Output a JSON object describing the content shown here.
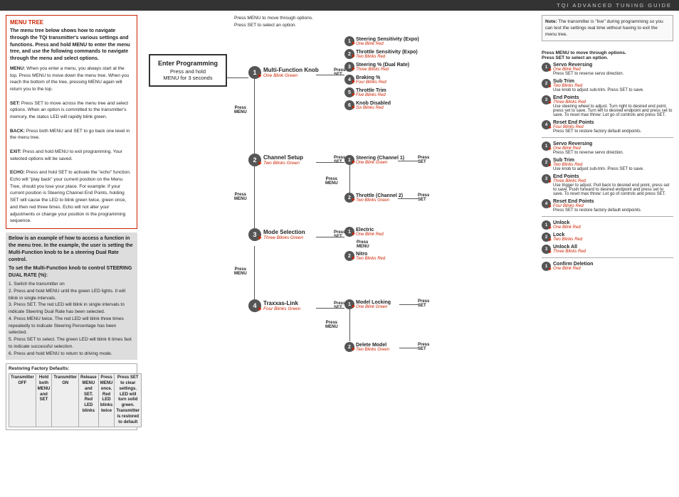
{
  "header": {
    "title": "TQi ADVANCED TUNING GUIDE"
  },
  "left_panel": {
    "menu_tree": {
      "title": "MENU TREE",
      "intro": "The menu tree below shows how to navigate through the TQi transmitter's various settings and functions. Press and hold MENU to enter the menu tree, and use the following commands to navigate through the menu and select options.",
      "items": [
        {
          "term": "MENU:",
          "description": "When you enter a menu, you always start at the top. Press MENU to move down the menu tree. When you reach the bottom of the tree, pressing MENU again will return you to the top."
        },
        {
          "term": "SET:",
          "description": "Press SET to move across the menu tree and select options. When an option is committed to the transmitter's memory, the status LED will rapidly blink green."
        },
        {
          "term": "BACK:",
          "description": "Press both MENU and SET to go back one level in the menu tree."
        },
        {
          "term": "EXIT:",
          "description": "Press and hold MENU to exit programming. Your selected options will be saved."
        },
        {
          "term": "ECHO:",
          "description": "Press and hold SET to activate the \"echo\" function. Echo will \"play back\" your current position on the Menu Tree, should you lose your place. For example: If your current position is Steering Channel End Points, holding SET will cause the LED to blink green twice, green once, and then red three times. Echo will not alter your adjustments or change your position in the programming sequence."
        }
      ]
    },
    "example": {
      "title": "Below is an example of how to access a function in the menu tree. In the example, the user is setting the Multi-Function knob to be a steering Dual Rate control.",
      "subtitle": "To set the Multi-Function knob to control STEERING DUAL RATE (%):",
      "steps": [
        "1. Switch the transmitter on",
        "2. Press and hold MENU until the green LED lights. It will blink in single intervals.",
        "3. Press SET. The red LED will blink in single intervals to indicate Steering Dual Rate has been selected.",
        "4. Press MENU twice. The red LED will blink three times repeatedly to indicate Steering Percentage has been selected.",
        "5. Press SET to select. The green LED will blink 6 times fast to indicate successful selection.",
        "6. Press and hold MENU to return to driving mode."
      ]
    },
    "factory_defaults": {
      "title": "Restoring Factory Defaults:",
      "columns": [
        "Transmitter OFF",
        "Hold both MENU and SET",
        "Transmitter ON",
        "Release MENU and SET. Red LED blinks",
        "Press MENU once. Red LED blinks twice",
        "Press SET to clear settings. LED will turn solid green. Transmitter is restored to default"
      ]
    }
  },
  "entry_box": {
    "title": "Enter Programming",
    "subtitle": "Press and hold",
    "detail": "MENU for 3 seconds"
  },
  "main_menu": [
    {
      "num": "1",
      "label": "Multi-Function Knob",
      "sublabel": "One Blink Green",
      "options": [
        {
          "num": "1",
          "label": "Steering Sensitivity (Expo)",
          "sublabel": "One Blink Red"
        },
        {
          "num": "2",
          "label": "Throttle Sensitivity (Expo)",
          "sublabel": "Two Blinks Red"
        },
        {
          "num": "3",
          "label": "Steering % (Dual Rate)",
          "sublabel": "Three Blinks Red"
        },
        {
          "num": "4",
          "label": "Braking %",
          "sublabel": "Four Blinks Red"
        },
        {
          "num": "5",
          "label": "Throttle Trim",
          "sublabel": "Five Blinks Red"
        },
        {
          "num": "6",
          "label": "Knob Disabled",
          "sublabel": "Six Blinks Red"
        }
      ]
    },
    {
      "num": "2",
      "label": "Channel Setup",
      "sublabel": "Two Blinks Green",
      "options": [
        {
          "num": "1",
          "label": "Steering (Channel 1)",
          "sublabel": "One Blink Green",
          "sub_options": [
            {
              "num": "1",
              "label": "Servo Reversing",
              "sublabel": "One Blink Red",
              "desc": "Press SET to reverse servo direction."
            },
            {
              "num": "2",
              "label": "Sub Trim",
              "sublabel": "Two Blinks Red",
              "desc": "Use knob to adjust sub-trim. Press SET to save."
            },
            {
              "num": "3",
              "label": "End Points",
              "sublabel": "Three Blinks Red",
              "desc": "Use steering wheel to adjust. Turn right to desired end point, press set to save. Turn left to desired endpoint and press set to save. To reset max throw: Let go of controls and press SET."
            },
            {
              "num": "4",
              "label": "Reset End Points",
              "sublabel": "Four Blinks Red",
              "desc": "Press SET to restore factory default endpoints."
            }
          ]
        },
        {
          "num": "2",
          "label": "Throttle (Channel 2)",
          "sublabel": "Two Blinks Green",
          "sub_options": [
            {
              "num": "1",
              "label": "Servo Reversing",
              "sublabel": "One Blink Red",
              "desc": "Press SET to reverse servo direction."
            },
            {
              "num": "2",
              "label": "Sub Trim",
              "sublabel": "Two Blinks Red",
              "desc": "Use knob to adjust sub-trim. Press SET to save."
            },
            {
              "num": "3",
              "label": "End Points",
              "sublabel": "Three Blinks Red",
              "desc": "Use trigger to adjust. Pull back to desired end point, press set to save. Push forward to desired endpoint and press set to save. To reset max throw: Let go of controls and press SET."
            },
            {
              "num": "4",
              "label": "Reset End Points",
              "sublabel": "Four Blinks Red",
              "desc": "Press SET to restore factory default endpoints."
            }
          ]
        }
      ]
    },
    {
      "num": "3",
      "label": "Mode Selection",
      "sublabel": "Three Blinks Green",
      "options": [
        {
          "num": "1",
          "label": "Electric",
          "sublabel": "One Blink Red"
        },
        {
          "num": "2",
          "label": "Nitro",
          "sublabel": "Two Blinks Red"
        }
      ]
    },
    {
      "num": "4",
      "label": "Traxxas-Link",
      "sublabel": "Four Blinks Green",
      "options": [
        {
          "num": "1",
          "label": "Model Locking",
          "sublabel": "One Blink Green",
          "sub_options": [
            {
              "num": "1",
              "label": "Unlock",
              "sublabel": "One Blink Red"
            },
            {
              "num": "2",
              "label": "Lock",
              "sublabel": "Two Blinks Red"
            },
            {
              "num": "3",
              "label": "Unlock All",
              "sublabel": "Three Blinks Red"
            }
          ]
        },
        {
          "num": "2",
          "label": "Delete Model",
          "sublabel": "Two Blinks Green",
          "sub_options": [
            {
              "num": "1",
              "label": "Confirm Deletion",
              "sublabel": "One Blink Red"
            }
          ]
        }
      ]
    }
  ],
  "top_info": {
    "line1": "Press MENU to move through options.",
    "line2": "Press SET to select an option."
  },
  "note_box": {
    "text": "Note: The transmitter is \"live\" during programming so you can test the settings real time without having to exit the menu tree."
  },
  "press_menu": "Press\nMENU",
  "press_set": "Press\nSET"
}
